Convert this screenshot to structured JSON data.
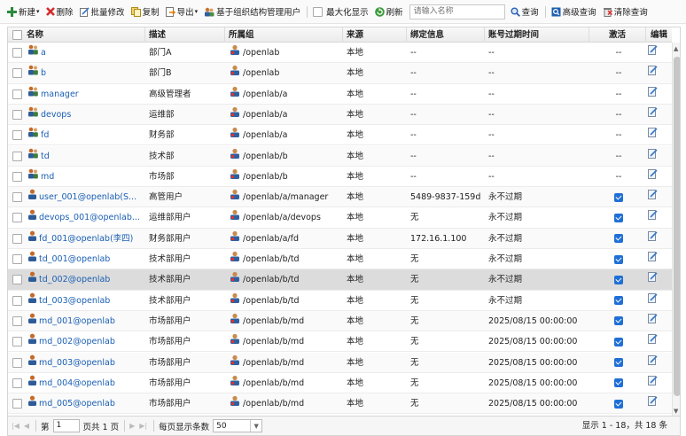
{
  "toolbar": {
    "new_label": "新建",
    "delete_label": "删除",
    "batch_edit_label": "批量修改",
    "copy_label": "复制",
    "export_label": "导出",
    "org_manage_label": "基于组织结构管理用户",
    "maximize_label": "最大化显示",
    "refresh_label": "刷新",
    "search_placeholder": "请输入名称",
    "query_label": "查询",
    "advanced_query_label": "高级查询",
    "clear_query_label": "清除查询"
  },
  "columns": {
    "name": "名称",
    "desc": "描述",
    "group": "所属组",
    "source": "来源",
    "binding": "绑定信息",
    "expire": "账号过期时间",
    "active": "激活",
    "edit": "编辑"
  },
  "rows": [
    {
      "name": "a",
      "desc": "部门A",
      "group": "/openlab",
      "source": "本地",
      "binding": "--",
      "expire": "--",
      "active": "--"
    },
    {
      "name": "b",
      "desc": "部门B",
      "group": "/openlab",
      "source": "本地",
      "binding": "--",
      "expire": "--",
      "active": "--"
    },
    {
      "name": "manager",
      "desc": "高级管理者",
      "group": "/openlab/a",
      "source": "本地",
      "binding": "--",
      "expire": "--",
      "active": "--"
    },
    {
      "name": "devops",
      "desc": "运维部",
      "group": "/openlab/a",
      "source": "本地",
      "binding": "--",
      "expire": "--",
      "active": "--"
    },
    {
      "name": "fd",
      "desc": "财务部",
      "group": "/openlab/a",
      "source": "本地",
      "binding": "--",
      "expire": "--",
      "active": "--"
    },
    {
      "name": "td",
      "desc": "技术部",
      "group": "/openlab/b",
      "source": "本地",
      "binding": "--",
      "expire": "--",
      "active": "--"
    },
    {
      "name": "md",
      "desc": "市场部",
      "group": "/openlab/b",
      "source": "本地",
      "binding": "--",
      "expire": "--",
      "active": "--"
    },
    {
      "name": "user_001@openlab(S...",
      "desc": "高管用户",
      "group": "/openlab/a/manager",
      "source": "本地",
      "binding": "5489-9837-159d",
      "expire": "永不过期",
      "active": ""
    },
    {
      "name": "devops_001@openlab...",
      "desc": "运维部用户",
      "group": "/openlab/a/devops",
      "source": "本地",
      "binding": "无",
      "expire": "永不过期",
      "active": ""
    },
    {
      "name": "fd_001@openlab(李四)",
      "desc": "财务部用户",
      "group": "/openlab/a/fd",
      "source": "本地",
      "binding": "172.16.1.100",
      "expire": "永不过期",
      "active": ""
    },
    {
      "name": "td_001@openlab",
      "desc": "技术部用户",
      "group": "/openlab/b/td",
      "source": "本地",
      "binding": "无",
      "expire": "永不过期",
      "active": ""
    },
    {
      "name": "td_002@openlab",
      "desc": "技术部用户",
      "group": "/openlab/b/td",
      "source": "本地",
      "binding": "无",
      "expire": "永不过期",
      "active": ""
    },
    {
      "name": "td_003@openlab",
      "desc": "技术部用户",
      "group": "/openlab/b/td",
      "source": "本地",
      "binding": "无",
      "expire": "永不过期",
      "active": ""
    },
    {
      "name": "md_001@openlab",
      "desc": "市场部用户",
      "group": "/openlab/b/md",
      "source": "本地",
      "binding": "无",
      "expire": "2025/08/15 00:00:00",
      "active": ""
    },
    {
      "name": "md_002@openlab",
      "desc": "市场部用户",
      "group": "/openlab/b/md",
      "source": "本地",
      "binding": "无",
      "expire": "2025/08/15 00:00:00",
      "active": ""
    },
    {
      "name": "md_003@openlab",
      "desc": "市场部用户",
      "group": "/openlab/b/md",
      "source": "本地",
      "binding": "无",
      "expire": "2025/08/15 00:00:00",
      "active": ""
    },
    {
      "name": "md_004@openlab",
      "desc": "市场部用户",
      "group": "/openlab/b/md",
      "source": "本地",
      "binding": "无",
      "expire": "2025/08/15 00:00:00",
      "active": ""
    },
    {
      "name": "md_005@openlab",
      "desc": "市场部用户",
      "group": "/openlab/b/md",
      "source": "本地",
      "binding": "无",
      "expire": "2025/08/15 00:00:00",
      "active": ""
    }
  ],
  "pager": {
    "page_prefix": "第",
    "page_value": "1",
    "page_suffix": "页共 1 页",
    "page_size_label": "每页显示条数",
    "page_size_value": "50",
    "info": "显示 1 - 18，共 18 条"
  },
  "colors": {
    "link": "#1a5fb4",
    "checked": "#1f6fd6",
    "selected_row": "#dcdcdc"
  }
}
